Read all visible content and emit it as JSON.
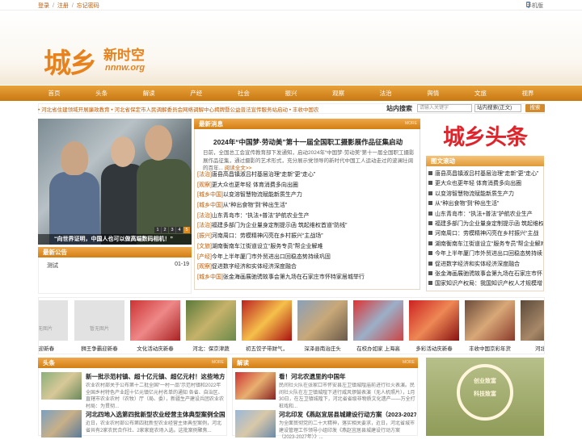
{
  "top": {
    "login": "登录",
    "register": "注册",
    "forgot": "忘记密码",
    "sep": "/",
    "mobile": "手机版"
  },
  "logo": {
    "title": "城乡",
    "sub": "新时空",
    "url": "nnnw.org"
  },
  "nav": [
    "首页",
    "头条",
    "解读",
    "产经",
    "社会",
    "振兴",
    "观察",
    "法治",
    "舆情",
    "文旅",
    "视界"
  ],
  "ticker": "• 河北省住建领域开展廉政教育 • 河北省保定市人民调解委员会网络调解中心揭牌暨公益普法宣传服务站启动 • 丰收中国农",
  "search": {
    "label": "站内搜索",
    "placeholder": "请输入关键字",
    "scope": "站内搜索(正文)",
    "button": "搜索"
  },
  "slideshow": {
    "caption": "“向世界证明，中国人也可以做高端数码相机！”",
    "pages": [
      "1",
      "2",
      "3",
      "4",
      "5"
    ],
    "active_page": 5
  },
  "notice": {
    "title": "最新公告",
    "more": "MORE",
    "items": [
      {
        "text": "测试",
        "date": "01-19"
      }
    ]
  },
  "latest": {
    "title": "最新消息",
    "more": "MORE",
    "headline": "2024年“中国梦·劳动美”第十一届全国职工摄影展作品征集启动",
    "summary": "日前，全国总工会宣传教育部下发通知，启动2024年“中国梦·劳动美”第十一届全国职工摄影展作品征集，通过摄影的艺术形式，充分展示党领导的新时代中国工人运动走过的波澜壮阔的百年...",
    "read": "阅读全文>>",
    "items": [
      {
        "cat": "[法治]",
        "text": "唐县高昌镇淑吕村基层治理“走新”更“走心”"
      },
      {
        "cat": "[观察]",
        "text": "更大众也更年轻 体育消费多向出圈"
      },
      {
        "cat": "[城乡中国]",
        "text": "以变溶智慧物流赋能新质生产力"
      },
      {
        "cat": "[城乡中国]",
        "text": "从“种出食物”到“种出生活”"
      },
      {
        "cat": "[法治]",
        "text": "山东青岛市：“执法+普法”护航农业生产"
      },
      {
        "cat": "[法治]",
        "text": "福建多部门为企业量身定制提示函 筑起维权首道“防线”"
      },
      {
        "cat": "[振兴]",
        "text": "河南周口：劳模精神闪亮在乡村振兴“主战场”"
      },
      {
        "cat": "[文旅]",
        "text": "湖南衡南车江街道设立“服务专员”帮企业解难"
      },
      {
        "cat": "[产经]",
        "text": "今年上半年厦门市外贸进出口回稳态势持续巩固"
      },
      {
        "cat": "[观察]",
        "text": "促进数字经济和实体经济深度融合"
      },
      {
        "cat": "[城乡中国]",
        "text": "张金海画展驰骋故事会第九场在石家庄市怀特家居城举行"
      }
    ]
  },
  "right": {
    "logo": "城乡头条",
    "title": "图文滚动",
    "items": [
      "唐县高昌镇淑吕村基层治理“走新”更“走心”",
      "更大众也更年轻 体育消费多向出圈",
      "以变溶智慧物流赋能新质生产力",
      "从“种出食物”到“种出生活”",
      "山东青岛市：“执法+普法”护航农业生产",
      "福建多部门为企业量身定制提示函 筑起维权",
      "河南周口：劳模精神闪亮在乡村振兴“主战",
      "湖南衡南车江街道设立“服务专员”帮企业解难",
      "今年上半年厦门市外贸进出口回稳态势持续",
      "促进数字经济和实体经济深度融合",
      "张金海画展驰骋故事会第九场在石家庄市怀",
      "国家知识产权局：我国知识产权人才规模增"
    ]
  },
  "strip": [
    "大”迎新春",
    "狮王争霸迎新春",
    "文化活动庆新春",
    "河北：保京津蔬",
    "初五饺子带财气，",
    "深泽县南治庄头",
    "在校办如家 上海高",
    "多彩活动庆新春",
    "丰收中国京彩年货",
    "河北省经"
  ],
  "headlines": {
    "title": "头条",
    "more": "MORE",
    "articles": [
      {
        "title": "新一批示范村镇、超十亿元镇、超亿元村！这些地方入",
        "summary": "农业农村部关于公布第十二批全国“一村一品”示范村镇和2022年全国乡村特色产业超十亿元镇亿元村名单的通知 各省、自治区、直辖市农业农村（农牧）厅（局、委），新疆生产建设兵团农业农村局：为贯彻..."
      },
      {
        "title": "河北四地入选第四批新型农业经营主体典型案例全国推",
        "summary": "近日，农业农村部公布第四批新型农业经营主体典型案例，河北省共有2家农民合作社、2家家庭农场入选。这批案例聚焦..."
      }
    ],
    "read": "阅读全文>>"
  },
  "jiedu": {
    "title": "解读",
    "more": "MORE",
    "articles": [
      {
        "title": "看！河北农遗里的中国年",
        "summary": "民间社火队在张家口市怀安县左卫镇城隍庙前进行社火表演。民间社火队在左卫镇城隍下进行威风锣鼓表演（无人机照片），1月30日，在左卫镇城隍下，河北省省级非物质文化遗产——万全打桩戏和..."
      },
      {
        "title": "河北印发《燕赵宜居县城建设行动方案（2023-2027",
        "summary": "为全面贯彻党的二十大精神，落实相关要求，近日，河北省城市建设管理工作领导小组印发《燕赵宜居县城建设行动方案（2023-2027年）》..."
      }
    ],
    "read": "阅读全文>>"
  },
  "promo": {
    "line1": "创业致富",
    "line2": "科技致富"
  },
  "colors": {
    "accent": "#e8821c",
    "nav": "#d9901f",
    "link": "#c05a00",
    "red": "#e0242b"
  }
}
